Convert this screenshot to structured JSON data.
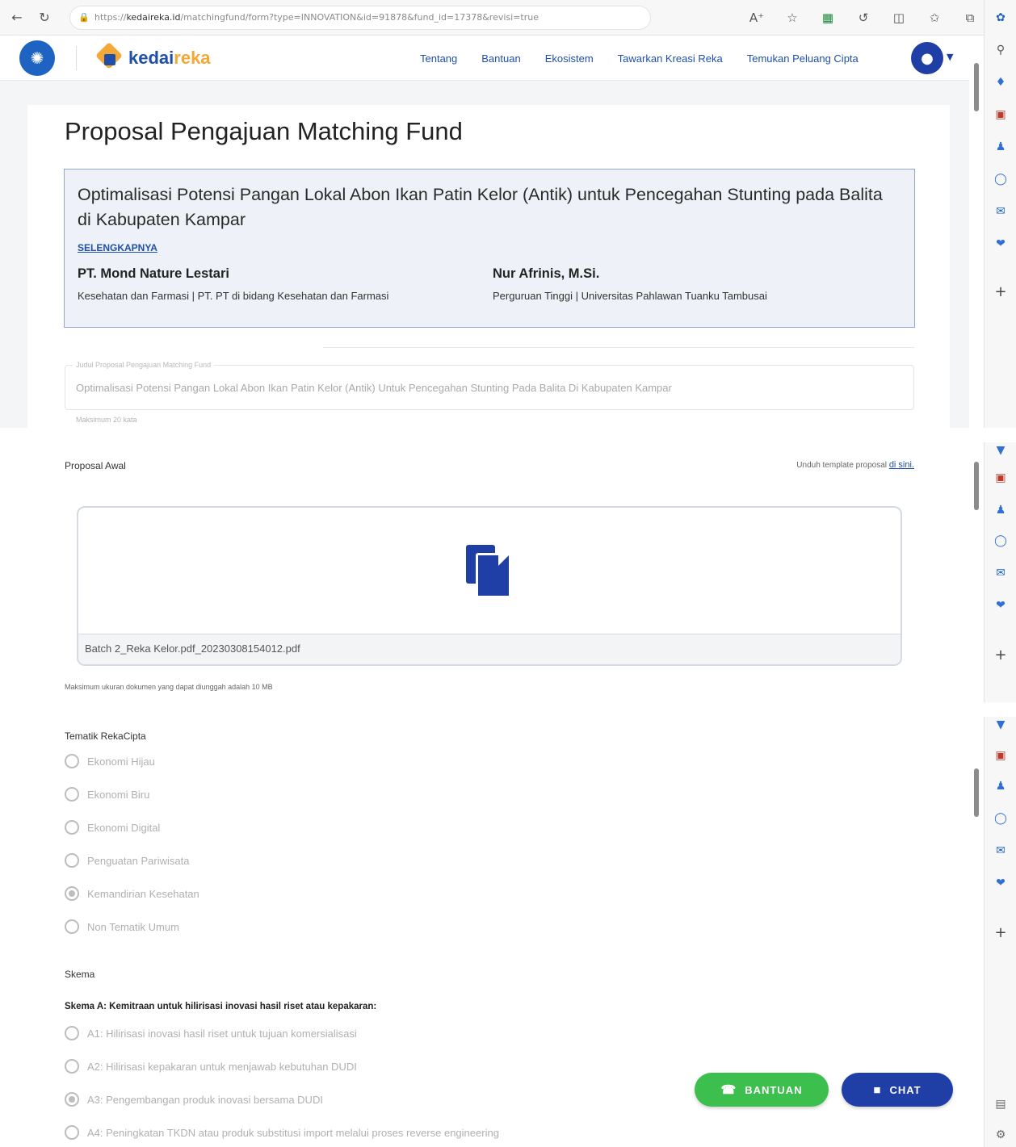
{
  "browser": {
    "url_scheme": "https://",
    "url_host": "kedaireka.id",
    "url_rest": "/matchingfund/form?type=INNOVATION&id=91878&fund_id=17378&revisi=true"
  },
  "header": {
    "brand_a": "kedai",
    "brand_b": "reka",
    "nav": [
      "Tentang",
      "Bantuan",
      "Ekosistem",
      "Tawarkan Kreasi Reka",
      "Temukan Peluang Cipta"
    ]
  },
  "page": {
    "title": "Proposal Pengajuan Matching Fund",
    "proposal_title": "Optimalisasi Potensi Pangan Lokal Abon Ikan Patin Kelor (Antik) untuk Pencegahan Stunting pada Balita di Kabupaten Kampar",
    "more_link": "SELENGKAPNYA",
    "partner_left": {
      "name": "PT. Mond Nature Lestari",
      "desc": "Kesehatan dan Farmasi | PT. PT di bidang Kesehatan dan Farmasi"
    },
    "partner_right": {
      "name": "Nur Afrinis, M.Si.",
      "desc": "Perguruan Tinggi | Universitas Pahlawan Tuanku Tambusai"
    },
    "field_title": {
      "legend": "Judul Proposal Pengajuan Matching Fund",
      "value": "Optimalisasi Potensi Pangan Lokal Abon Ikan Patin Kelor (Antik) Untuk Pencegahan Stunting Pada Balita Di Kabupaten Kampar",
      "help": "Maksimum 20 kata"
    }
  },
  "upload": {
    "label": "Proposal Awal",
    "template_text": "Unduh template proposal",
    "template_link": "di sini.",
    "file_name": "Batch 2_Reka Kelor.pdf_20230308154012.pdf",
    "note": "Maksimum ukuran dokumen yang dapat diunggah adalah 10 MB"
  },
  "tematik": {
    "label": "Tematik RekaCipta",
    "options": [
      "Ekonomi Hijau",
      "Ekonomi Biru",
      "Ekonomi Digital",
      "Penguatan Pariwisata",
      "Kemandirian Kesehatan",
      "Non Tematik Umum"
    ],
    "selected": "Kemandirian Kesehatan"
  },
  "skema": {
    "label": "Skema",
    "sub_label": "Skema A: Kemitraan untuk hilirisasi inovasi hasil riset atau kepakaran:",
    "options": [
      "A1: Hilirisasi inovasi hasil riset untuk tujuan komersialisasi",
      "A2: Hilirisasi kepakaran untuk menjawab kebutuhan DUDI",
      "A3: Pengembangan produk inovasi bersama DUDI",
      "A4: Peningkatan TKDN atau produk substitusi import melalui proses reverse engineering"
    ],
    "selected": "A3: Pengembangan produk inovasi bersama DUDI"
  },
  "fab": {
    "help": "BANTUAN",
    "chat": "CHAT"
  }
}
